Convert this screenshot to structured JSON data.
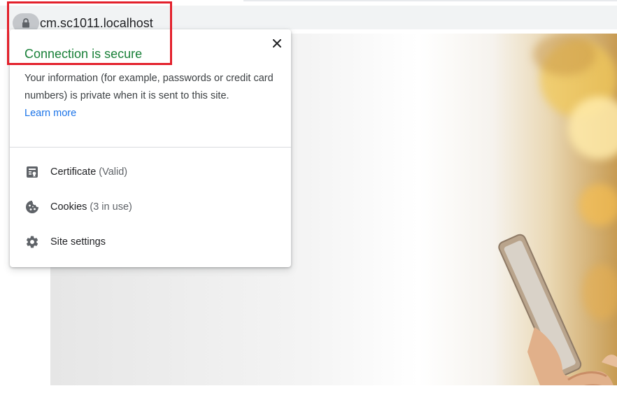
{
  "address_bar": {
    "url": "cm.sc1011.localhost",
    "lock_icon": "lock-icon"
  },
  "popup": {
    "title": "Connection is secure",
    "description": "Your information (for example, passwords or credit card numbers) is private when it is sent to this site.",
    "learn_more": "Learn more",
    "close_icon": "close-icon",
    "items": [
      {
        "icon": "certificate-icon",
        "label": "Certificate",
        "sublabel": "(Valid)"
      },
      {
        "icon": "cookie-icon",
        "label": "Cookies",
        "sublabel": "(3 in use)"
      },
      {
        "icon": "gear-icon",
        "label": "Site settings",
        "sublabel": ""
      }
    ]
  },
  "colors": {
    "secure_green": "#188038",
    "link_blue": "#1a73e8",
    "highlight_red": "#e3202b",
    "omnibox_bg": "#f1f3f4"
  }
}
